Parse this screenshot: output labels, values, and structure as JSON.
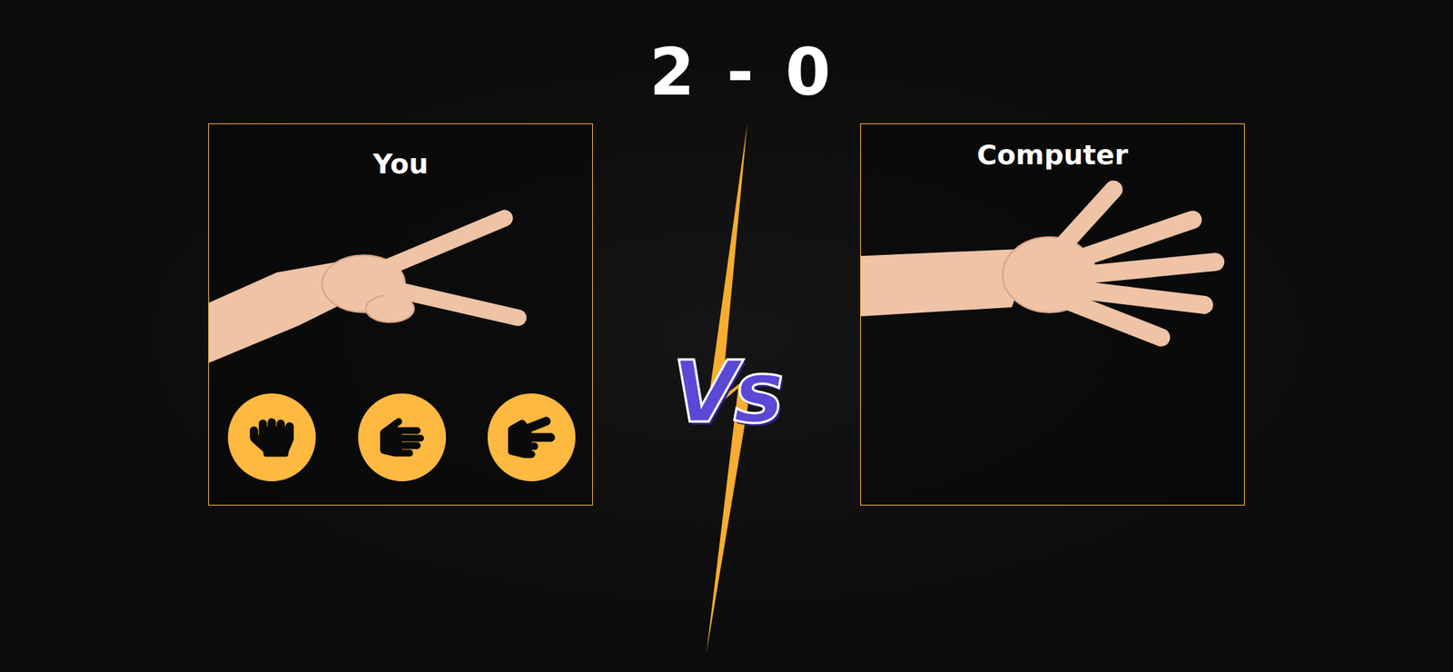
{
  "score": {
    "you": "2",
    "separator": "-",
    "computer": "0"
  },
  "vs": "Vs",
  "players": [
    {
      "label": "You",
      "hand": "scissors",
      "choices": [
        {
          "kind": "rock"
        },
        {
          "kind": "paper"
        },
        {
          "kind": "scissors"
        }
      ]
    },
    {
      "label": "Computer",
      "hand": "paper",
      "choices": []
    }
  ]
}
